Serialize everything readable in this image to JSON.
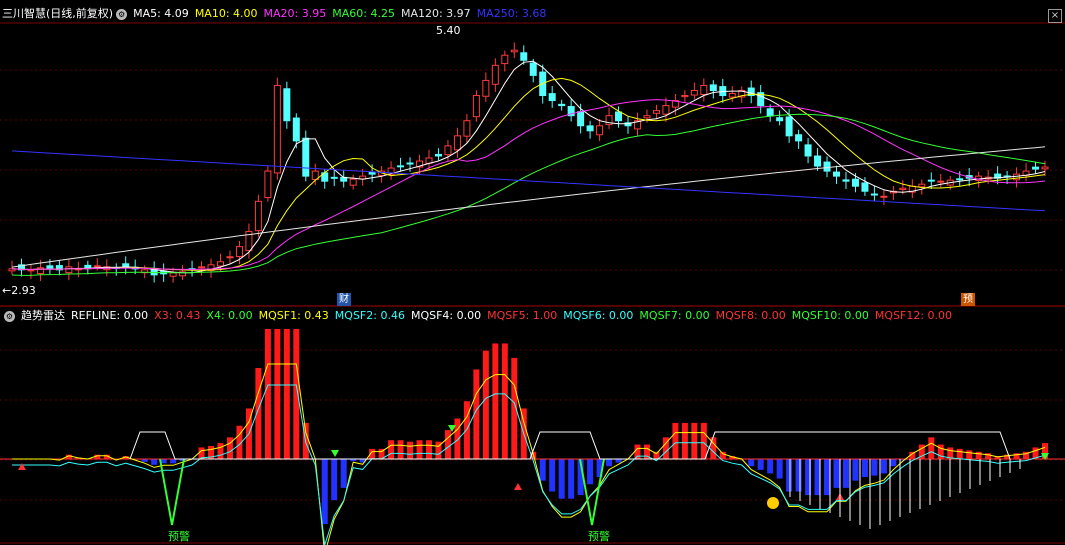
{
  "top_header": {
    "title": "三川智慧",
    "period": "(日线,前复权)",
    "ma": [
      {
        "label": "MA5: 4.09",
        "color": "#ffffff"
      },
      {
        "label": "MA10: 4.00",
        "color": "#ffff00"
      },
      {
        "label": "MA20: 3.95",
        "color": "#ff33ff"
      },
      {
        "label": "MA60: 4.25",
        "color": "#33ff33"
      },
      {
        "label": "MA120: 3.97",
        "color": "#e6e6e6"
      },
      {
        "label": "MA250: 3.68",
        "color": "#3333ff"
      }
    ]
  },
  "price_labels": {
    "high": "5.40",
    "low": "2.93"
  },
  "event_tags": {
    "cai": "财",
    "yu": "预"
  },
  "bottom_header": {
    "title": "趋势雷达",
    "fields": [
      {
        "label": "REFLINE: 0.00",
        "color": "#ffffff"
      },
      {
        "label": "X3: 0.43",
        "color": "#ff3333"
      },
      {
        "label": "X4: 0.00",
        "color": "#33ff33"
      },
      {
        "label": "MQSF1: 0.43",
        "color": "#ffff00"
      },
      {
        "label": "MQSF2: 0.46",
        "color": "#33ffff"
      },
      {
        "label": "MQSF4: 0.00",
        "color": "#ffffff"
      },
      {
        "label": "MQSF5: 1.00",
        "color": "#ff3333"
      },
      {
        "label": "MQSF6: 0.00",
        "color": "#33ffff"
      },
      {
        "label": "MQSF7: 0.00",
        "color": "#33ff33"
      },
      {
        "label": "MQSF8: 0.00",
        "color": "#ff3333"
      },
      {
        "label": "MQSF10: 0.00",
        "color": "#33ff33"
      },
      {
        "label": "MQSF12: 0.00",
        "color": "#ff3333"
      }
    ]
  },
  "warn_labels": [
    "预警",
    "预警"
  ],
  "chart_data": {
    "type": "candlestick",
    "note_price_range": [
      2.93,
      5.4
    ],
    "closes": [
      3.08,
      3.07,
      3.07,
      3.09,
      3.08,
      3.07,
      3.1,
      3.08,
      3.09,
      3.11,
      3.1,
      3.09,
      3.1,
      3.08,
      3.07,
      3.02,
      3.03,
      3.04,
      3.05,
      3.07,
      3.1,
      3.12,
      3.15,
      3.2,
      3.3,
      3.45,
      3.75,
      4.05,
      4.9,
      4.55,
      4.35,
      4.0,
      4.05,
      3.95,
      3.98,
      3.95,
      3.97,
      4.0,
      4.02,
      4.05,
      4.08,
      4.1,
      4.12,
      4.15,
      4.18,
      4.2,
      4.3,
      4.4,
      4.55,
      4.8,
      4.95,
      5.1,
      5.2,
      5.25,
      5.15,
      5.0,
      4.8,
      4.75,
      4.7,
      4.6,
      4.5,
      4.45,
      4.5,
      4.6,
      4.55,
      4.5,
      4.55,
      4.6,
      4.65,
      4.7,
      4.75,
      4.8,
      4.85,
      4.9,
      4.85,
      4.8,
      4.82,
      4.85,
      4.8,
      4.7,
      4.6,
      4.55,
      4.4,
      4.35,
      4.2,
      4.1,
      4.05,
      4.0,
      3.95,
      3.9,
      3.85,
      3.82,
      3.8,
      3.85,
      3.88,
      3.9,
      3.92,
      3.95,
      3.95,
      3.96,
      3.97,
      3.98,
      4.0,
      3.99,
      3.98,
      4.0,
      4.02,
      4.05,
      4.07,
      4.09
    ],
    "ma5_last": 4.09,
    "ma10_last": 4.0,
    "ma20_last": 3.95,
    "ma60_last": 4.25,
    "ma120_last": 3.97,
    "ma250_last": 3.68
  }
}
